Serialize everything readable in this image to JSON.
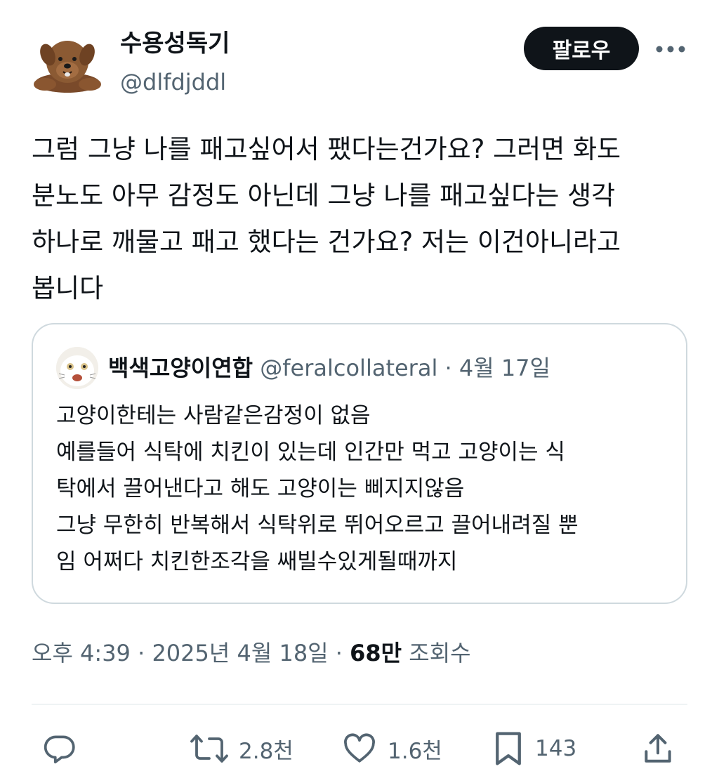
{
  "author": {
    "name": "수용성독기",
    "handle": "@dlfdjddl",
    "avatar_icon": "brown-dog-avatar"
  },
  "header": {
    "follow_label": "팔로우",
    "more_icon": "more-horizontal-icon"
  },
  "tweet": {
    "lines": [
      "그럼 그냥 나를 패고싶어서 팼다는건가요? 그러면 화도",
      "분노도 아무 감정도 아닌데 그냥 나를 패고싶다는 생각",
      "하나로 깨물고 패고 했다는 건가요? 저는 이건아니라고",
      "봅니다"
    ]
  },
  "quote": {
    "name": "백색고양이연합",
    "handle": "@feralcollateral",
    "separator": "·",
    "date": "4월 17일",
    "avatar_icon": "white-cat-avatar",
    "lines": [
      "고양이한테는 사람같은감정이 없음",
      "예를들어 식탁에 치킨이 있는데 인간만 먹고 고양이는 식",
      "탁에서 끌어낸다고 해도 고양이는 삐지지않음",
      "그냥 무한히 반복해서 식탁위로 뛰어오르고 끌어내려질 뿐",
      "임 어쩌다 치킨한조각을 쌔빌수있게될때까지"
    ]
  },
  "meta": {
    "time": "오후 4:39",
    "separator": " · ",
    "date": "2025년 4월 18일",
    "views_count": "68만",
    "views_label": "조회수"
  },
  "actions": {
    "reply": {
      "icon": "reply-icon"
    },
    "repost": {
      "icon": "repost-icon",
      "count": "2.8천"
    },
    "like": {
      "icon": "heart-icon",
      "count": "1.6천"
    },
    "bookmark": {
      "icon": "bookmark-icon",
      "count": "143"
    },
    "share": {
      "icon": "share-icon"
    }
  },
  "colors": {
    "text": "#0f1419",
    "muted": "#536471",
    "border": "#cfd9de",
    "follow_bg": "#0f1419"
  }
}
